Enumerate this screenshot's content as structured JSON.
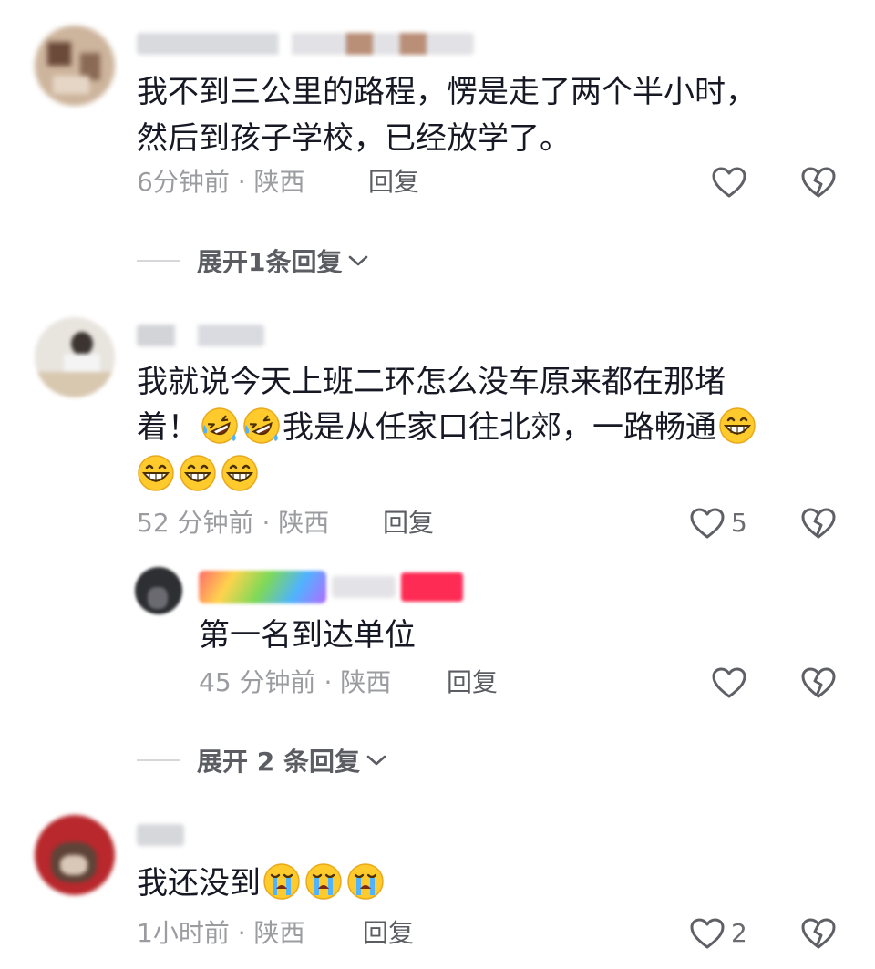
{
  "comments": [
    {
      "id": "c1",
      "text_lines": [
        "我不到三公里的路程，愣是走了两个半小时，",
        "然后到孩子学校，已经放学了。"
      ],
      "time": "6分钟前",
      "sep": "·",
      "location": "陕西",
      "reply_label": "回复",
      "like_count": "",
      "expand_label": "展开1条回复"
    },
    {
      "id": "c2",
      "text_line1": "我就说今天上班二环怎么没车原来都在那堵",
      "text_line2_a": "着！",
      "text_line2_b": "我是从任家口往北郊，一路畅通",
      "time": "52 分钟前",
      "sep": "·",
      "location": "陕西",
      "reply_label": "回复",
      "like_count": "5",
      "reply": {
        "text": "第一名到达单位",
        "time": "45 分钟前",
        "sep": "·",
        "location": "陕西",
        "reply_label": "回复"
      },
      "expand_label": "展开 2 条回复"
    },
    {
      "id": "c3",
      "text": "我还没到",
      "time": "1小时前",
      "sep": "·",
      "location": "陕西",
      "reply_label": "回复",
      "like_count": "2"
    }
  ],
  "icons": {
    "like": "heart-outline-icon",
    "dislike": "broken-heart-icon",
    "expand": "chevron-down-icon",
    "emoji_laugh": "rolling-laughing-emoji",
    "emoji_grin": "grinning-emoji",
    "emoji_cry": "crying-emoji"
  },
  "colors": {
    "text": "#161823",
    "meta": "#9b9ca0",
    "badge": "#fe2c55"
  }
}
